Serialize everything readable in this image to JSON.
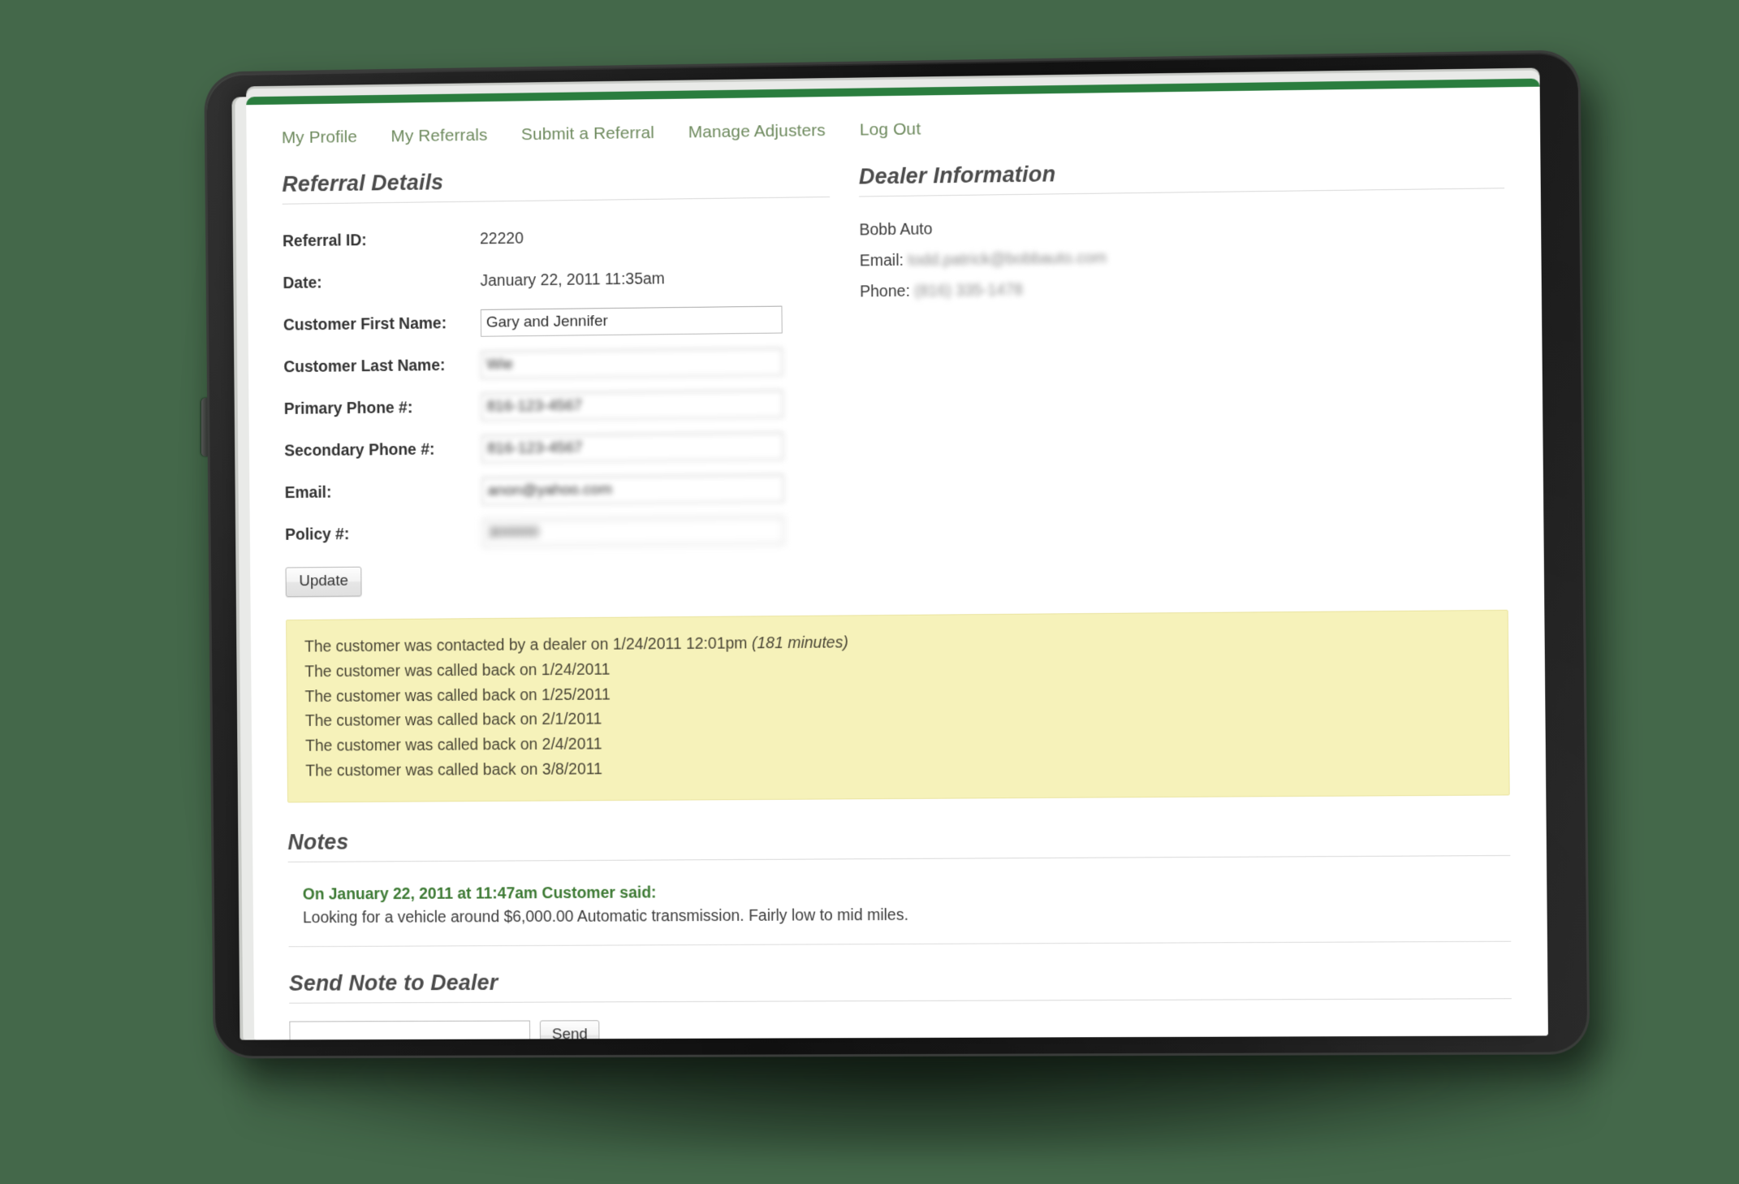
{
  "nav": {
    "items": [
      {
        "label": "My Profile"
      },
      {
        "label": "My Referrals"
      },
      {
        "label": "Submit a Referral"
      },
      {
        "label": "Manage Adjusters"
      },
      {
        "label": "Log Out"
      }
    ]
  },
  "referral_details": {
    "heading": "Referral Details",
    "fields": [
      {
        "label": "Referral ID:",
        "value": "22220",
        "type": "text",
        "redacted": false
      },
      {
        "label": "Date:",
        "value": "January 22, 2011 11:35am",
        "type": "text",
        "redacted": false
      },
      {
        "label": "Customer First Name:",
        "value": "Gary and Jennifer",
        "type": "input",
        "redacted": false
      },
      {
        "label": "Customer Last Name:",
        "value": "Wie",
        "type": "input",
        "redacted": true
      },
      {
        "label": "Primary Phone #:",
        "value": "816-123-4567",
        "type": "input",
        "redacted": true
      },
      {
        "label": "Secondary Phone #:",
        "value": "816-123-4567",
        "type": "input",
        "redacted": true
      },
      {
        "label": "Email:",
        "value": "anon@yahoo.com",
        "type": "input",
        "redacted": true
      },
      {
        "label": "Policy #:",
        "value": "300000",
        "type": "input",
        "redacted": true
      }
    ],
    "update_label": "Update"
  },
  "dealer_information": {
    "heading": "Dealer Information",
    "name": "Bobb Auto",
    "email_label": "Email:",
    "email_value": "todd.patrick@bobbauto.com",
    "phone_label": "Phone:",
    "phone_value": "(816) 335-1478"
  },
  "activity": {
    "lines": [
      {
        "text": "The customer was contacted by a dealer on 1/24/2011 12:01pm ",
        "italic_suffix": "(181 minutes)"
      },
      {
        "text": "The customer was called back on 1/24/2011",
        "italic_suffix": ""
      },
      {
        "text": "The customer was called back on 1/25/2011",
        "italic_suffix": ""
      },
      {
        "text": "The customer was called back on 2/1/2011",
        "italic_suffix": ""
      },
      {
        "text": "The customer was called back on 2/4/2011",
        "italic_suffix": ""
      },
      {
        "text": "The customer was called back on 3/8/2011",
        "italic_suffix": ""
      }
    ],
    "background_color": "#f6f2ba"
  },
  "notes": {
    "heading": "Notes",
    "entries": [
      {
        "title": "On January 22, 2011 at 11:47am Customer said:",
        "body": "Looking for a vehicle around $6,000.00 Automatic transmission. Fairly low to mid miles."
      }
    ]
  },
  "send_note": {
    "heading": "Send Note to Dealer",
    "input_value": "",
    "input_placeholder": "",
    "send_label": "Send"
  },
  "colors": {
    "background": "#44684a",
    "nav_link": "#6e8a5e",
    "page_topbar": "#2a7d3e",
    "note_title": "#3d7a34",
    "activity_bg": "#f6f2ba"
  }
}
